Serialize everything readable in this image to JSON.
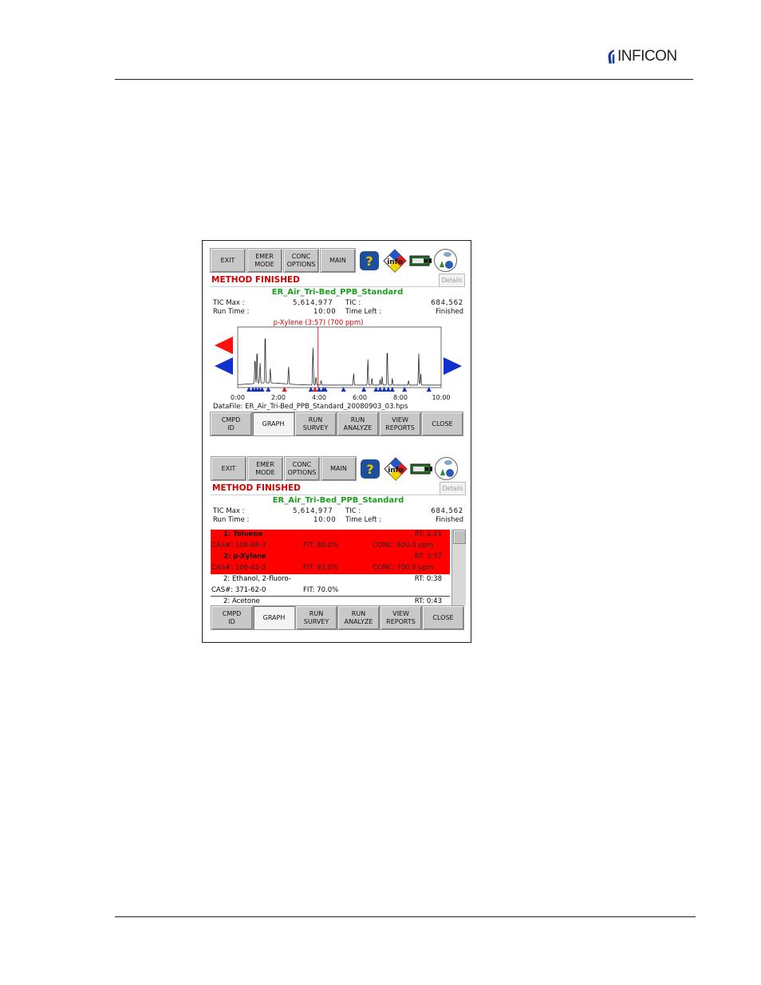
{
  "header": {
    "brand": "INFICON"
  },
  "screens": [
    {
      "toolbar": {
        "exit": "EXIT",
        "emer": "EMER\nMODE",
        "conc": "CONC\nOPTIONS",
        "main": "MAIN"
      },
      "status": "METHOD FINISHED",
      "details": "Details",
      "method_name": "ER_Air_Tri-Bed_PPB_Standard",
      "tic_max_label": "TIC Max :",
      "tic_max_value": "5,614,977",
      "tic_label": "TIC :",
      "tic_value": "684,562",
      "run_time_label": "Run Time :",
      "run_time_value": "10:00",
      "time_left_label": "Time Left :",
      "time_left_value": "Finished",
      "bottom": {
        "cmpd": "CMPD\nID",
        "graph": "GRAPH",
        "survey": "RUN\nSURVEY",
        "analyze": "RUN\nANALYZE",
        "reports": "VIEW\nREPORTS",
        "close": "CLOSE"
      }
    },
    {
      "toolbar": {
        "exit": "EXIT",
        "emer": "EMER\nMODE",
        "conc": "CONC\nOPTIONS",
        "main": "MAIN"
      },
      "status": "METHOD FINISHED",
      "details": "Details",
      "method_name": "ER_Air_Tri-Bed_PPB_Standard",
      "tic_max_label": "TIC Max :",
      "tic_max_value": "5,614,977",
      "tic_label": "TIC :",
      "tic_value": "684,562",
      "run_time_label": "Run Time :",
      "run_time_value": "10:00",
      "time_left_label": "Time Left :",
      "time_left_value": "Finished",
      "bottom": {
        "cmpd": "CMPD\nID",
        "graph": "GRAPH",
        "survey": "RUN\nSURVEY",
        "analyze": "RUN\nANALYZE",
        "reports": "VIEW\nREPORTS",
        "close": "CLOSE"
      }
    }
  ],
  "icons": [
    "help-icon",
    "info-icon",
    "battery-icon",
    "gas-network-icon",
    "chevron-left-icon",
    "chevron-right-icon"
  ],
  "chart": {
    "marker_label": "p-Xylene (3:57) (700 ppm)",
    "datafile": "DataFile: ER_Air_Tri-Bed_PPB_Standard_20080903_03.hps"
  },
  "chart_data": {
    "type": "line",
    "title": "p-Xylene (3:57) (700 ppm)",
    "xlabel": "",
    "ylabel": "",
    "xlim": [
      0,
      10
    ],
    "xticks": [
      "0:00",
      "2:00",
      "4:00",
      "6:00",
      "8:00",
      "10:00"
    ],
    "marker_x": 3.95,
    "peaks": [
      {
        "x": 0.85,
        "h": 0.45
      },
      {
        "x": 0.95,
        "h": 0.6
      },
      {
        "x": 1.1,
        "h": 0.35
      },
      {
        "x": 1.35,
        "h": 0.9
      },
      {
        "x": 1.6,
        "h": 0.25
      },
      {
        "x": 2.5,
        "h": 0.3
      },
      {
        "x": 3.7,
        "h": 0.65
      },
      {
        "x": 3.85,
        "h": 0.15
      },
      {
        "x": 4.1,
        "h": 0.08
      },
      {
        "x": 5.7,
        "h": 0.2
      },
      {
        "x": 6.4,
        "h": 0.45
      },
      {
        "x": 6.6,
        "h": 0.12
      },
      {
        "x": 7.1,
        "h": 0.15
      },
      {
        "x": 7.0,
        "h": 0.1
      },
      {
        "x": 7.35,
        "h": 0.65
      },
      {
        "x": 7.6,
        "h": 0.12
      },
      {
        "x": 8.4,
        "h": 0.08
      },
      {
        "x": 8.9,
        "h": 0.55
      },
      {
        "x": 9.0,
        "h": 0.2
      }
    ],
    "blue_markers": [
      0.55,
      0.75,
      0.9,
      1.05,
      1.2,
      1.5,
      2.3,
      3.6,
      4.0,
      4.2,
      4.3,
      5.2,
      6.2,
      6.8,
      7.0,
      7.2,
      7.4,
      7.6,
      8.2,
      9.4
    ],
    "red_markers": [
      2.3,
      3.8
    ]
  },
  "compound_list": [
    {
      "name": "1: Toluene",
      "rt": "RT:  2:21",
      "cas": "CAS#: 108-88-3",
      "fit": "FIT:  88.0%",
      "conc": "CONC: 600.0 ppm",
      "highlight": true
    },
    {
      "name": "2: p-Xylene",
      "rt": "RT:  3:57",
      "cas": "CAS#: 106-42-3",
      "fit": "FIT:  93.0%",
      "conc": "CONC: 700.0 ppm",
      "highlight": true
    },
    {
      "name": "2: Ethanol, 2-fluoro-",
      "rt": "RT:  0:38",
      "cas": "CAS#: 371-62-0",
      "fit": "FIT:  70.0%",
      "conc": "",
      "highlight": false
    },
    {
      "name": "2: Acetone",
      "rt": "RT:  0:43",
      "cas": "",
      "fit": "",
      "conc": "",
      "highlight": false
    }
  ]
}
